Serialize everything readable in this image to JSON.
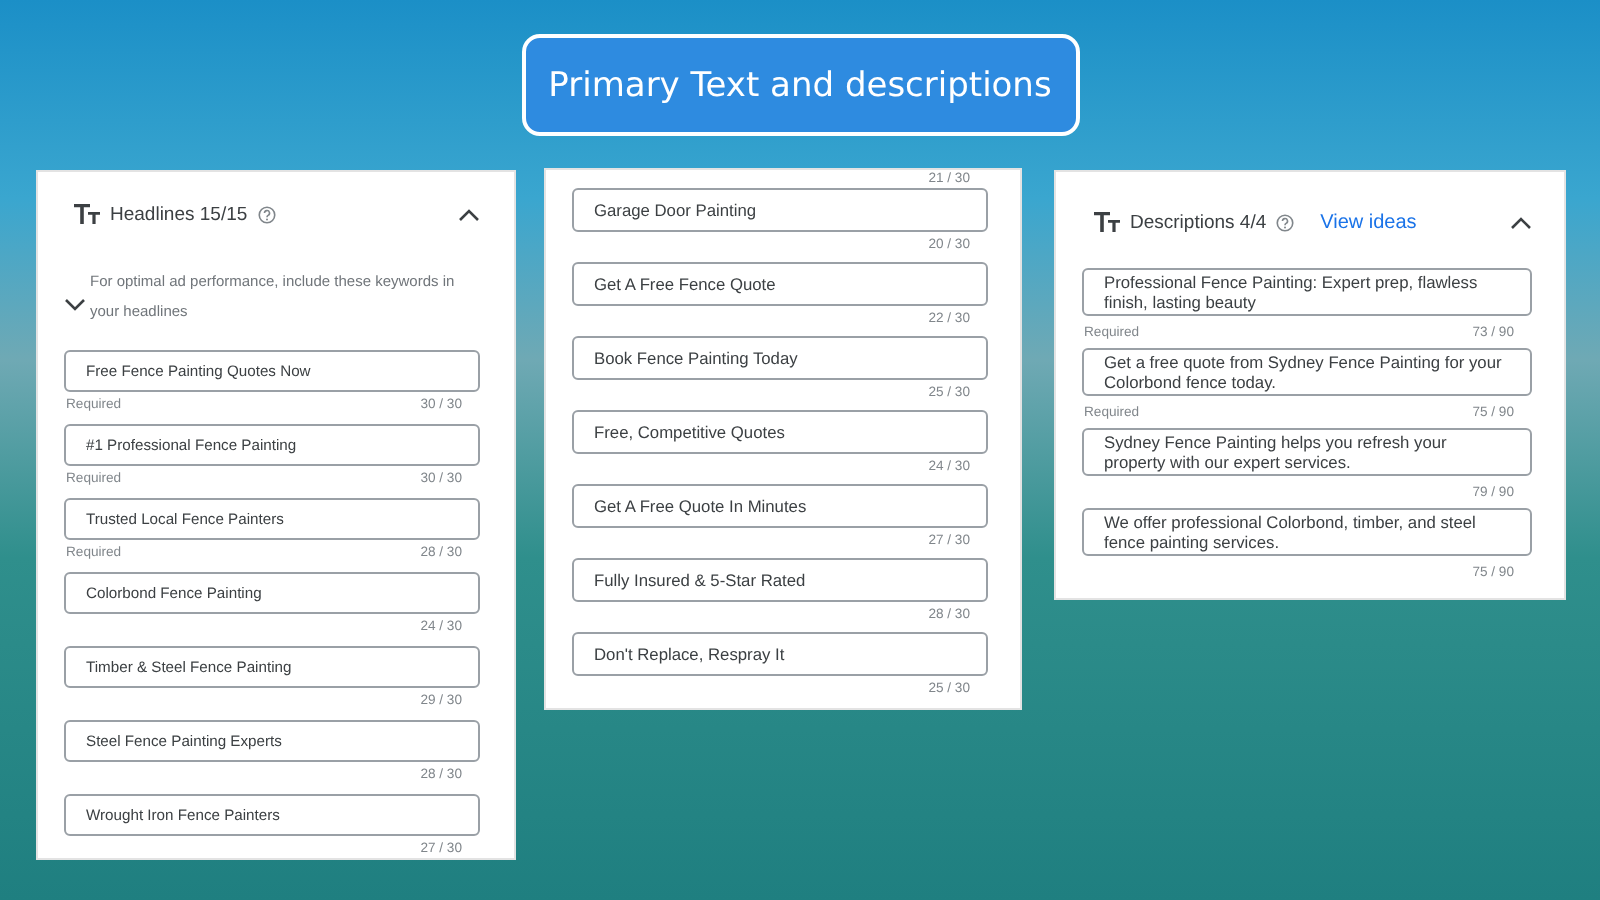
{
  "banner": {
    "title": "Primary Text and descriptions"
  },
  "headlines_panel": {
    "title": "Headlines 15/15",
    "hint": "For optimal ad performance, include these keywords in your headlines",
    "expanded": true,
    "items": [
      {
        "text": "Free Fence Painting Quotes Now",
        "note": "Required",
        "count": "30 / 30"
      },
      {
        "text": "#1 Professional Fence Painting",
        "note": "Required",
        "count": "30 / 30"
      },
      {
        "text": "Trusted Local Fence Painters",
        "note": "Required",
        "count": "28 / 30"
      },
      {
        "text": "Colorbond Fence Painting",
        "count": "24 / 30"
      },
      {
        "text": "Timber & Steel Fence Painting",
        "count": "29 / 30"
      },
      {
        "text": "Steel Fence Painting Experts",
        "count": "28 / 30"
      },
      {
        "text": "Wrought Iron Fence Painters",
        "count": "27 / 30"
      }
    ]
  },
  "headlines_continued": {
    "top_count": "21 / 30",
    "items": [
      {
        "text": "Garage Door Painting",
        "count": "20 / 30"
      },
      {
        "text": "Get A Free Fence Quote",
        "count": "22 / 30"
      },
      {
        "text": "Book Fence Painting Today",
        "count": "25 / 30"
      },
      {
        "text": "Free, Competitive Quotes",
        "count": "24 / 30"
      },
      {
        "text": "Get A Free Quote In Minutes",
        "count": "27 / 30"
      },
      {
        "text": "Fully Insured & 5-Star Rated",
        "count": "28 / 30"
      },
      {
        "text": "Don't Replace, Respray It",
        "count": "25 / 30"
      }
    ]
  },
  "descriptions_panel": {
    "title": "Descriptions 4/4",
    "link": "View ideas",
    "expanded": true,
    "items": [
      {
        "text": "Professional Fence Painting: Expert prep, flawless finish, lasting beauty",
        "note": "Required",
        "count": "73 / 90"
      },
      {
        "text": "Get a free quote from Sydney Fence Painting for your Colorbond fence today.",
        "note": "Required",
        "count": "75 / 90"
      },
      {
        "text": "Sydney Fence Painting helps you refresh your property with our expert services.",
        "count": "79 / 90"
      },
      {
        "text": "We offer professional Colorbond, timber, and steel fence painting services.",
        "count": "75 / 90"
      }
    ]
  }
}
